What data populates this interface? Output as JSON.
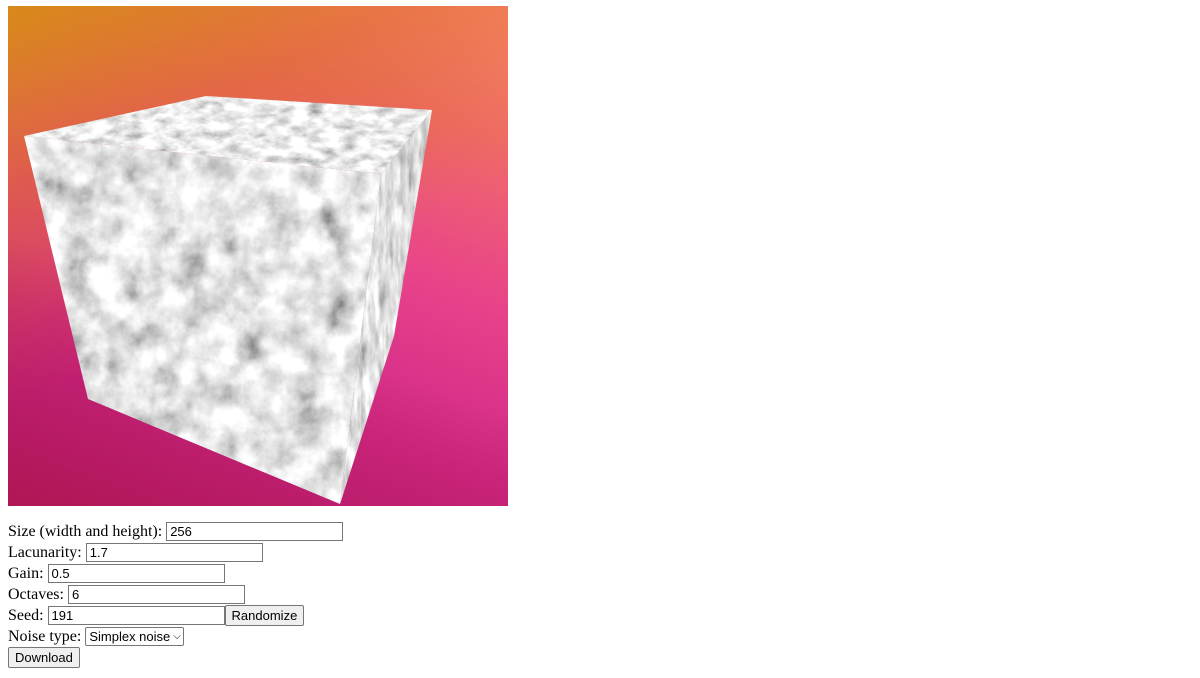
{
  "canvas": {
    "background_colors": [
      "#d48a18",
      "#ff8a7a",
      "#e8428a",
      "#c01e96",
      "#aa1e46"
    ],
    "cube_texture": "gray simplex noise"
  },
  "controls": {
    "size": {
      "label": "Size (width and height):",
      "value": "256"
    },
    "lacunarity": {
      "label": "Lacunarity:",
      "value": "1.7"
    },
    "gain": {
      "label": "Gain:",
      "value": "0.5"
    },
    "octaves": {
      "label": "Octaves:",
      "value": "6"
    },
    "seed": {
      "label": "Seed:",
      "value": "191",
      "randomize_label": "Randomize"
    },
    "noise_type": {
      "label": "Noise type:",
      "selected": "Simplex noise"
    },
    "download_label": "Download"
  }
}
